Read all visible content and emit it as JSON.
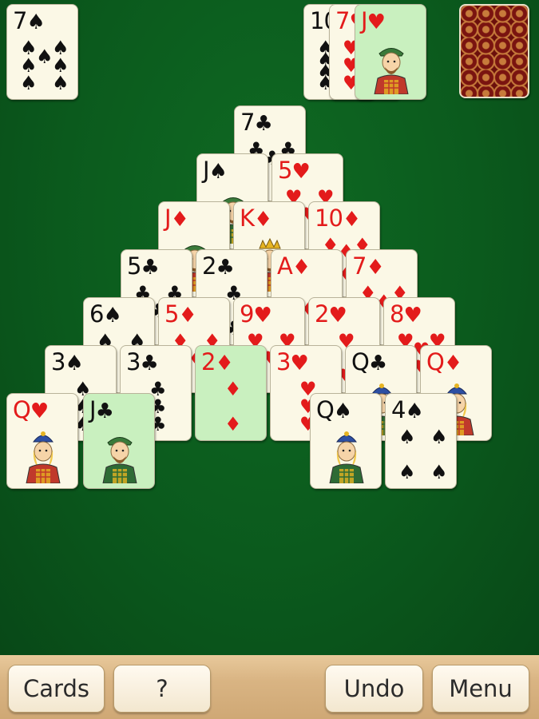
{
  "colors": {
    "felt": "#0b5a1d",
    "card": "#fbf8e6",
    "selected": "#c9f0bf",
    "red": "#e31b1b",
    "black": "#111111"
  },
  "stock": {
    "top_card": {
      "rank": "7",
      "suit": "♠",
      "color": "black"
    }
  },
  "waste": [
    {
      "rank": "10",
      "suit": "♠",
      "color": "black"
    },
    {
      "rank": "7",
      "suit": "♥",
      "color": "red"
    },
    {
      "rank": "J",
      "suit": "♥",
      "color": "red",
      "selected": true,
      "face": "jack"
    }
  ],
  "deck_back": {
    "name": "card-back"
  },
  "pyramid": [
    {
      "rank": "7",
      "suit": "♣",
      "color": "black"
    },
    {
      "rank": "J",
      "suit": "♠",
      "color": "black",
      "face": "jack"
    },
    {
      "rank": "5",
      "suit": "♥",
      "color": "red"
    },
    {
      "rank": "J",
      "suit": "♦",
      "color": "red",
      "face": "jack"
    },
    {
      "rank": "K",
      "suit": "♦",
      "color": "red",
      "face": "king"
    },
    {
      "rank": "10",
      "suit": "♦",
      "color": "red"
    },
    {
      "rank": "5",
      "suit": "♣",
      "color": "black"
    },
    {
      "rank": "2",
      "suit": "♣",
      "color": "black"
    },
    {
      "rank": "A",
      "suit": "♦",
      "color": "red"
    },
    {
      "rank": "7",
      "suit": "♦",
      "color": "red"
    },
    {
      "rank": "6",
      "suit": "♠",
      "color": "black"
    },
    {
      "rank": "5",
      "suit": "♦",
      "color": "red"
    },
    {
      "rank": "9",
      "suit": "♥",
      "color": "red"
    },
    {
      "rank": "2",
      "suit": "♥",
      "color": "red"
    },
    {
      "rank": "8",
      "suit": "♥",
      "color": "red"
    },
    {
      "rank": "3",
      "suit": "♠",
      "color": "black"
    },
    {
      "rank": "3",
      "suit": "♣",
      "color": "black"
    },
    {
      "rank": "2",
      "suit": "♦",
      "color": "red",
      "selected": true
    },
    {
      "rank": "3",
      "suit": "♥",
      "color": "red"
    },
    {
      "rank": "Q",
      "suit": "♣",
      "color": "black",
      "face": "queen"
    },
    {
      "rank": "Q",
      "suit": "♦",
      "color": "red",
      "face": "queen"
    },
    {
      "rank": "Q",
      "suit": "♥",
      "color": "red",
      "face": "queen"
    },
    {
      "rank": "J",
      "suit": "♣",
      "color": "black",
      "selected": true,
      "face": "jack"
    },
    {
      "rank": "Q",
      "suit": "♠",
      "color": "black",
      "face": "queen"
    },
    {
      "rank": "4",
      "suit": "♠",
      "color": "black"
    }
  ],
  "toolbar": {
    "cards_label": "Cards",
    "help_label": "?",
    "undo_label": "Undo",
    "menu_label": "Menu"
  }
}
